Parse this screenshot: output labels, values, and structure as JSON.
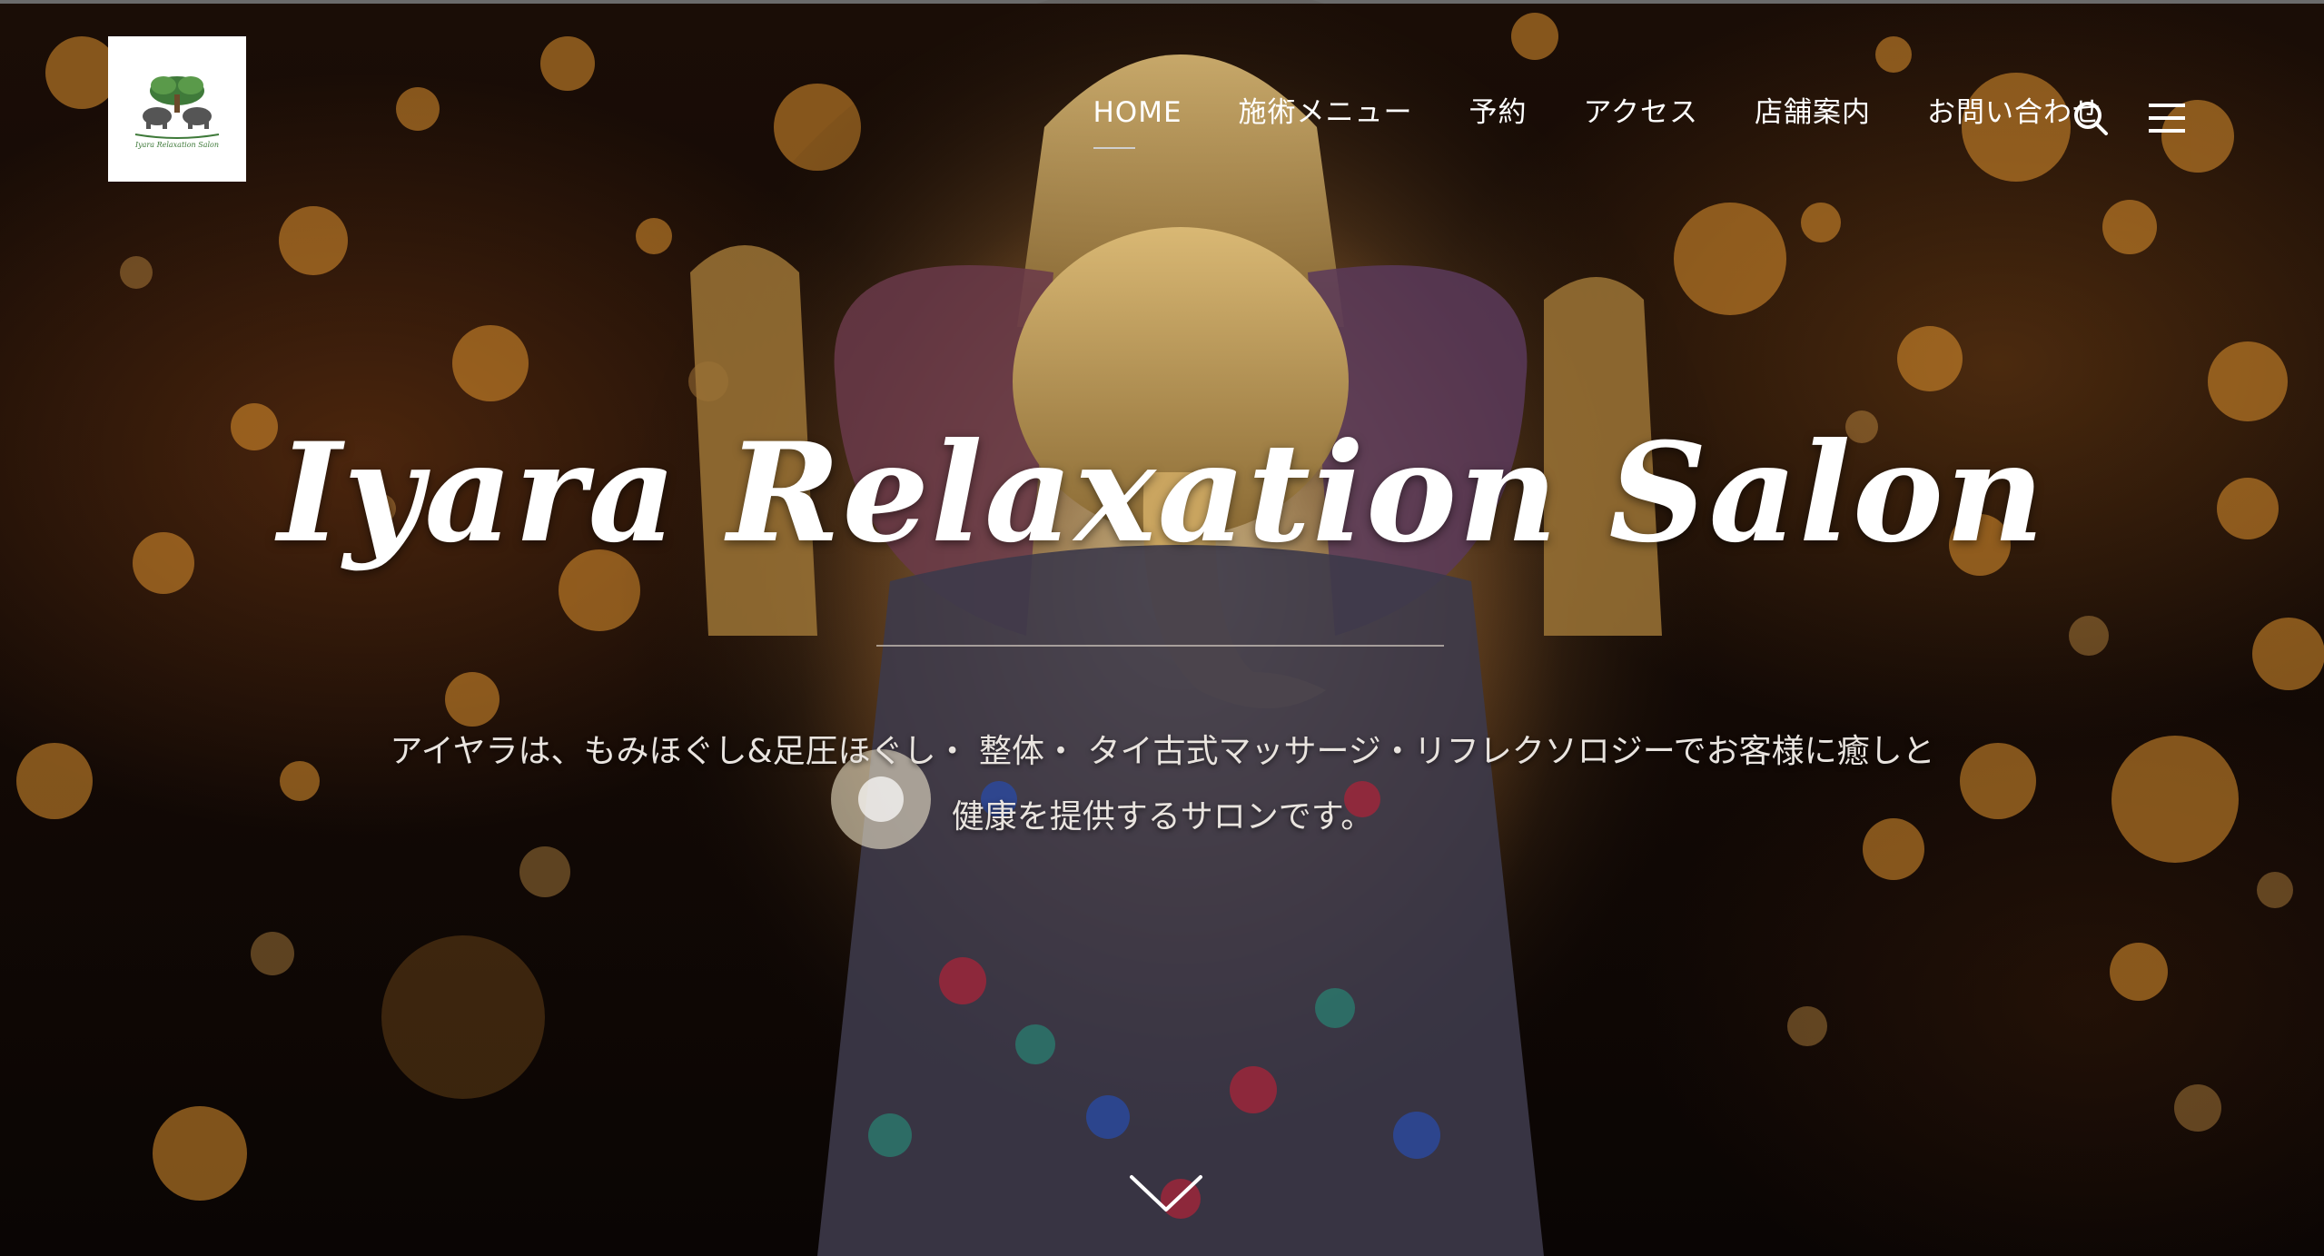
{
  "site": {
    "logo_icon": "elephant-tree-logo",
    "logo_text": "Iyara Relaxation Salon"
  },
  "nav": {
    "items": [
      {
        "label": "HOME"
      },
      {
        "label": "施術メニュー"
      },
      {
        "label": "予約"
      },
      {
        "label": "アクセス"
      },
      {
        "label": "店舗案内"
      },
      {
        "label": "お問い合わせ"
      }
    ],
    "search_icon": "search-icon",
    "menu_icon": "hamburger-menu-icon"
  },
  "hero": {
    "title": "Iyara Relaxation Salon",
    "tagline_line1": "アイヤラは、もみほぐし&足圧ほぐし・ 整体・ タイ古式マッサージ・リフレクソロジーでお客様に癒しと",
    "tagline_line2": "健康を提供するサロンです。",
    "scroll_icon": "chevron-down-icon"
  },
  "colors": {
    "text": "#ffffff",
    "accent_gold": "#c8964a",
    "logo_green": "#3f7a3a"
  }
}
